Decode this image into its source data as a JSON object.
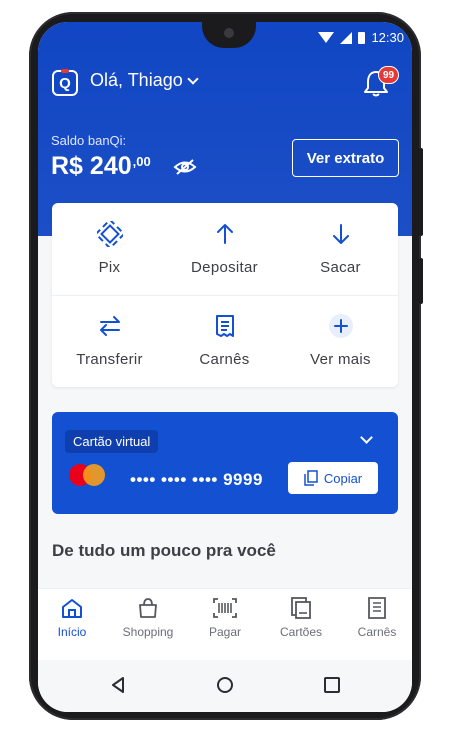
{
  "status_bar": {
    "time": "12:30"
  },
  "header": {
    "greeting": "Olá, Thiago",
    "logo_letter": "Q",
    "notification_count": "99"
  },
  "balance": {
    "label": "Saldo banQi:",
    "currency": "R$",
    "amount_int": "240",
    "amount_cents": ",00",
    "statement_button": "Ver extrato"
  },
  "actions": [
    {
      "label": "Pix",
      "icon": "pix-icon"
    },
    {
      "label": "Depositar",
      "icon": "arrow-up-icon"
    },
    {
      "label": "Sacar",
      "icon": "arrow-down-icon"
    },
    {
      "label": "Transferir",
      "icon": "transfer-icon"
    },
    {
      "label": "Carnês",
      "icon": "receipt-icon"
    },
    {
      "label": "Ver mais",
      "icon": "plus-icon"
    }
  ],
  "virtual_card": {
    "tag": "Cartão virtual",
    "masked_number": "•••• •••• •••• 9999",
    "copy_label": "Copiar"
  },
  "section": {
    "title": "De tudo um pouco pra você"
  },
  "bottom_nav": [
    {
      "label": "Início",
      "icon": "home-icon",
      "active": true
    },
    {
      "label": "Shopping",
      "icon": "shopping-bag-icon",
      "active": false
    },
    {
      "label": "Pagar",
      "icon": "barcode-scan-icon",
      "active": false
    },
    {
      "label": "Cartões",
      "icon": "cards-icon",
      "active": false
    },
    {
      "label": "Carnês",
      "icon": "receipt-icon",
      "active": false
    }
  ],
  "colors": {
    "brand_blue": "#1146c4",
    "card_blue": "#1450d2",
    "badge_red": "#e53935"
  }
}
